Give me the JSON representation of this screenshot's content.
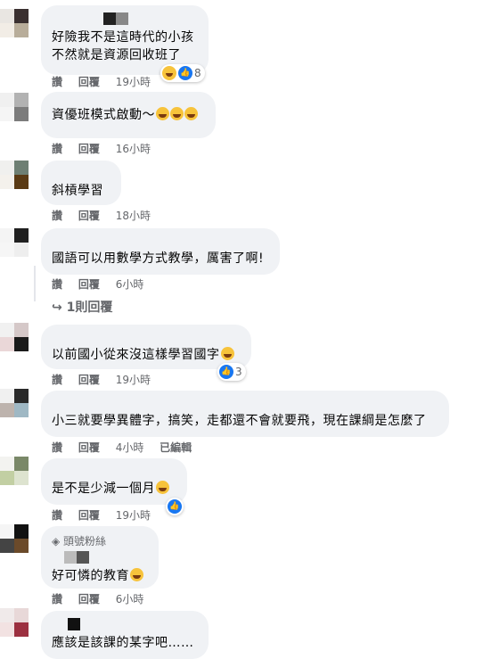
{
  "common": {
    "like_label": "讚",
    "reply_label": "回覆",
    "edited_label": "已編輯"
  },
  "comments": [
    {
      "text_lines": [
        "好險我不是這時代的小孩",
        "不然就是資源回收班了"
      ],
      "time": "19小時",
      "reaction_count": "8",
      "reactions": [
        "haha",
        "like"
      ]
    },
    {
      "text_lines": [
        "資優班模式啟動～"
      ],
      "emojis": [
        "grinning-emoji",
        "grinning-emoji",
        "grinning-emoji"
      ],
      "time": "16小時"
    },
    {
      "text_lines": [
        "斜槓學習"
      ],
      "time": "18小時"
    },
    {
      "text_lines": [
        "國語可以用數學方式教學，厲害了啊!"
      ],
      "time": "6小時",
      "replies_link": "1則回覆"
    },
    {
      "text_lines": [
        "以前國小從來沒這樣學習國字"
      ],
      "emojis": [
        "expressionless-emoji"
      ],
      "time": "19小時",
      "reaction_count": "3",
      "reactions": [
        "like"
      ]
    },
    {
      "text_lines": [
        "小三就要學異體字，搞笑，走都還不會就要飛，現在課綱是怎麼了"
      ],
      "time": "4小時",
      "edited": true
    },
    {
      "text_lines": [
        "是不是少減一個月"
      ],
      "emojis": [
        "thinking-emoji"
      ],
      "time": "19小時",
      "reactions": [
        "like"
      ]
    },
    {
      "badge": "頭號粉絲",
      "text_lines": [
        "好可憐的教育"
      ],
      "emojis": [
        "tears-of-joy-emoji"
      ],
      "time": "6小時"
    },
    {
      "text_lines": [
        "應該是該課的某字吧……"
      ]
    }
  ]
}
